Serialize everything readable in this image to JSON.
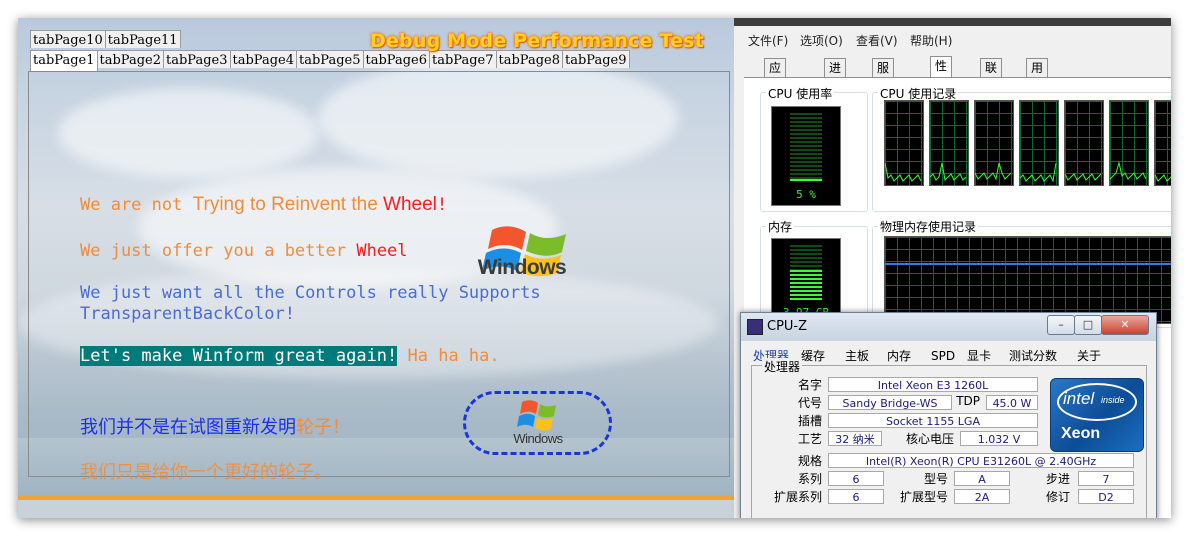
{
  "demo": {
    "title": "Debug Mode Performance Test",
    "tabs_row1": [
      "tabPage10",
      "tabPage11"
    ],
    "tabs_row2": [
      "tabPage1",
      "tabPage2",
      "tabPage3",
      "tabPage4",
      "tabPage5",
      "tabPage6",
      "tabPage7",
      "tabPage8",
      "tabPage9"
    ],
    "line1": {
      "a": "We are not ",
      "b": "Trying to Reinvent the ",
      "c": "Wheel",
      "d": "!"
    },
    "line2": {
      "a": "We just offer you a better ",
      "b": "Wheel"
    },
    "line3": {
      "a": "We  just  want  all  the  Controls  really  Supports",
      "b": "TransparentBackColor!"
    },
    "line4": {
      "a": "Let's make Winform great again!",
      "b": " Ha ha ha."
    },
    "line5": {
      "a": "我们并不是在试图重新发明",
      "b": "轮子！"
    },
    "line6": "我们只是给你一个更好的轮子。",
    "logo_text": "Windows",
    "logo_text_small": "Windows"
  },
  "taskmgr": {
    "menu": [
      "文件(F)",
      "选项(O)",
      "查看(V)",
      "帮助(H)"
    ],
    "tabs": [
      "应用程序",
      "进程",
      "服务",
      "性能",
      "联网",
      "用户"
    ],
    "active_tab": "性能",
    "cpu_usage_label": "CPU 使用率",
    "cpu_usage_value": "5 %",
    "cpu_usage_level": 0.05,
    "cpu_history_label": "CPU 使用记录",
    "mem_label": "内存",
    "mem_value": "3.97 GB",
    "mem_level": 0.55,
    "mem_history_label": "物理内存使用记录"
  },
  "cpuz": {
    "title": "CPU-Z",
    "tabs": [
      "处理器",
      "缓存",
      "主板",
      "内存",
      "SPD",
      "显卡",
      "测试分数",
      "关于"
    ],
    "active_tab": "处理器",
    "group": "处理器",
    "labels": {
      "name": "名字",
      "codename": "代号",
      "tdp": "TDP",
      "package": "插槽",
      "tech": "工艺",
      "voltage": "核心电压",
      "spec": "规格",
      "family": "系列",
      "model": "型号",
      "stepping": "步进",
      "ext_family": "扩展系列",
      "ext_model": "扩展型号",
      "revision": "修订"
    },
    "values": {
      "name": "Intel Xeon E3 1260L",
      "codename": "Sandy Bridge-WS",
      "tdp": "45.0 W",
      "package": "Socket 1155 LGA",
      "tech": "32 纳米",
      "voltage": "1.032 V",
      "spec": "Intel(R) Xeon(R) CPU E31260L @ 2.40GHz",
      "family": "6",
      "model": "A",
      "stepping": "7",
      "ext_family": "6",
      "ext_model": "2A",
      "revision": "D2"
    },
    "logo": {
      "brand": "intel",
      "inside": "inside",
      "product": "Xeon"
    },
    "controls": {
      "min": "–",
      "max": "□",
      "close": "✕"
    }
  }
}
